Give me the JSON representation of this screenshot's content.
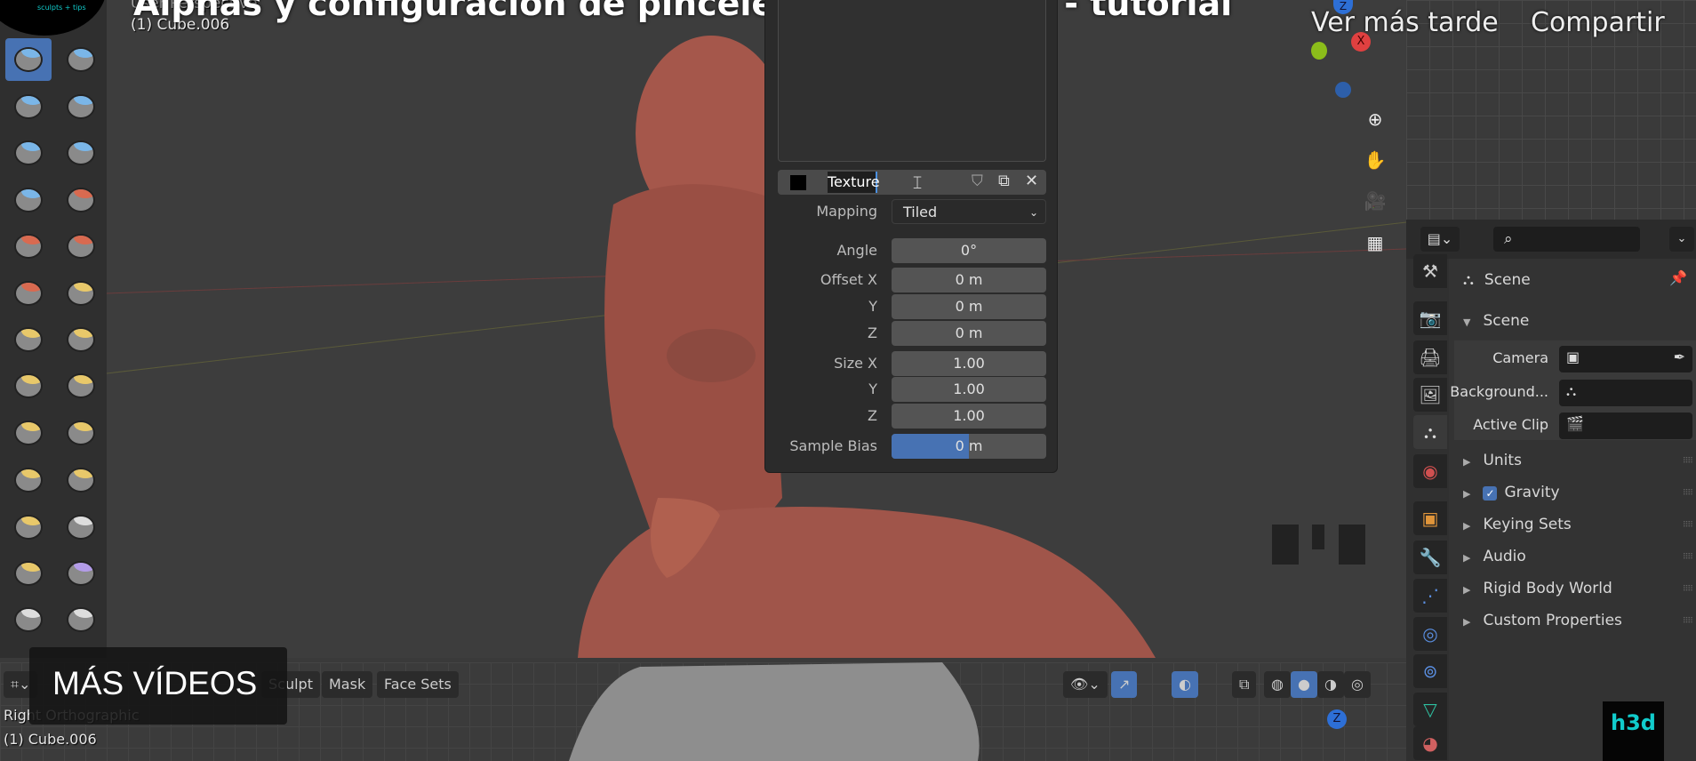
{
  "video_overlay": {
    "title": "Alphas y configuración de pinceles para Blender - tutorial",
    "watch_later": "Ver más tarde",
    "share": "Compartir",
    "more_videos": "MÁS VÍDEOS",
    "channel_tagline": "sculpts + tips",
    "watermark": "h3d"
  },
  "viewport": {
    "view_name": "User Perspective",
    "object": "(1) Cube.006"
  },
  "bottom_viewport": {
    "view_name": "Right Orthographic",
    "object": "(1) Cube.006",
    "menus": [
      "Sculpt",
      "Mask",
      "Face Sets"
    ]
  },
  "gizmo": {
    "z": "Z",
    "x": "X",
    "y": "Y"
  },
  "texture_panel": {
    "texture_name": "Texture",
    "mapping_label": "Mapping",
    "mapping_value": "Tiled",
    "rows": [
      {
        "label": "Angle",
        "value": "0°"
      },
      {
        "label": "Offset X",
        "value": "0 m"
      },
      {
        "label": "Y",
        "value": "0 m"
      },
      {
        "label": "Z",
        "value": "0 m"
      },
      {
        "label": "Size X",
        "value": "1.00"
      },
      {
        "label": "Y",
        "value": "1.00"
      },
      {
        "label": "Z",
        "value": "1.00"
      }
    ],
    "sample_bias_label": "Sample Bias",
    "sample_bias_value": "0 m",
    "sample_bias_fraction": 0.5
  },
  "properties": {
    "context": "Scene",
    "section": "Scene",
    "fields": [
      {
        "label": "Camera"
      },
      {
        "label": "Background..."
      },
      {
        "label": "Active Clip"
      }
    ],
    "subpanels": [
      "Units",
      "Gravity",
      "Keying Sets",
      "Audio",
      "Rigid Body World",
      "Custom Properties"
    ],
    "gravity_checked": true
  },
  "colors": {
    "accent": "#4772b3",
    "skin": "#a5574b"
  }
}
